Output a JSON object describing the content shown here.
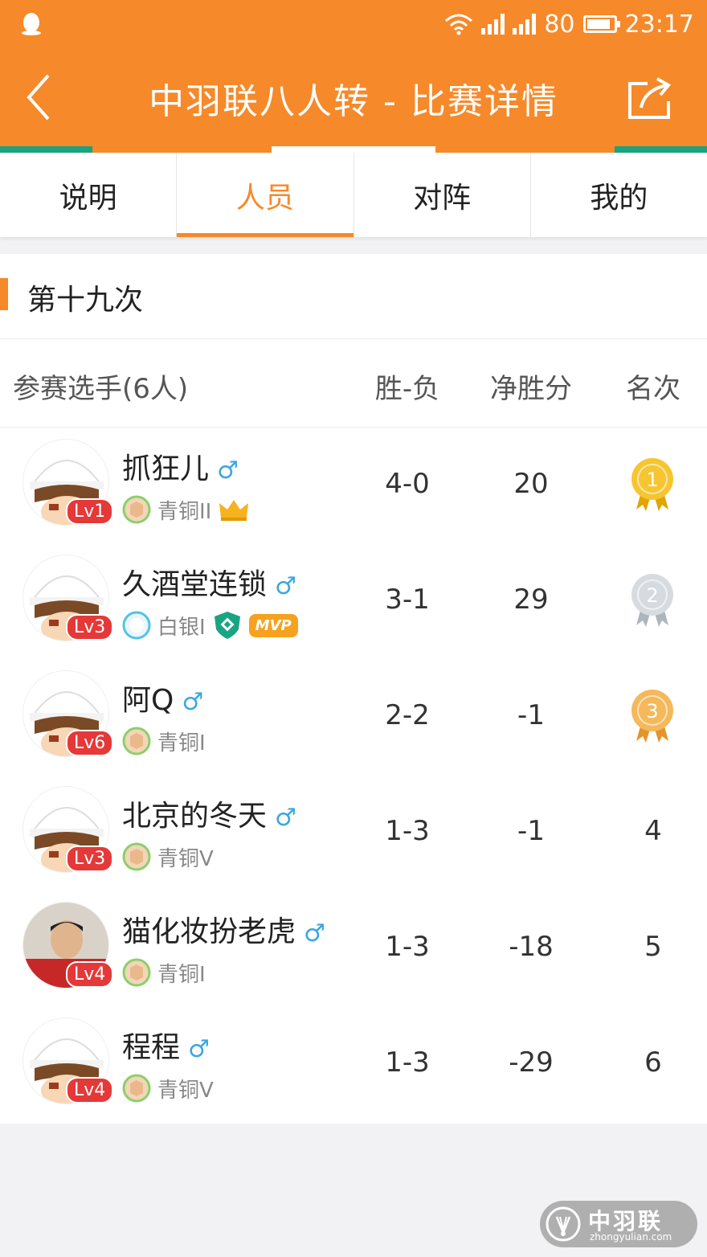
{
  "status_bar": {
    "battery": "80",
    "time": "23:17"
  },
  "header": {
    "title": "中羽联八人转 - 比赛详情",
    "back_icon": "back-icon",
    "share_icon": "share-icon"
  },
  "tabs": [
    {
      "label": "说明",
      "active": false
    },
    {
      "label": "人员",
      "active": true
    },
    {
      "label": "对阵",
      "active": false
    },
    {
      "label": "我的",
      "active": false
    }
  ],
  "section": {
    "title": "第十九次"
  },
  "table": {
    "headers": {
      "players": "参赛选手(6人)",
      "win_loss": "胜-负",
      "net_points": "净胜分",
      "rank": "名次"
    },
    "rows": [
      {
        "name": "抓狂儿",
        "gender": "♂",
        "level": "Lv1",
        "tier": "青铜II",
        "win_loss": "4-0",
        "net": "20",
        "rank": "1",
        "medal": "gold",
        "badges": [
          "crown"
        ],
        "photo": false
      },
      {
        "name": "久酒堂连锁",
        "gender": "♂",
        "level": "Lv3",
        "tier": "白银I",
        "win_loss": "3-1",
        "net": "29",
        "rank": "2",
        "medal": "silver",
        "badges": [
          "shield",
          "MVP"
        ],
        "photo": false
      },
      {
        "name": "阿Q",
        "gender": "♂",
        "level": "Lv6",
        "tier": "青铜I",
        "win_loss": "2-2",
        "net": "-1",
        "rank": "3",
        "medal": "bronze",
        "badges": [],
        "photo": false
      },
      {
        "name": "北京的冬天",
        "gender": "♂",
        "level": "Lv3",
        "tier": "青铜V",
        "win_loss": "1-3",
        "net": "-1",
        "rank": "4",
        "medal": "",
        "badges": [],
        "photo": false
      },
      {
        "name": "猫化妆扮老虎",
        "gender": "♂",
        "level": "Lv4",
        "tier": "青铜I",
        "win_loss": "1-3",
        "net": "-18",
        "rank": "5",
        "medal": "",
        "badges": [],
        "photo": true
      },
      {
        "name": "程程",
        "gender": "♂",
        "level": "Lv4",
        "tier": "青铜V",
        "win_loss": "1-3",
        "net": "-29",
        "rank": "6",
        "medal": "",
        "badges": [],
        "photo": false
      }
    ]
  },
  "watermark": {
    "title": "中羽联",
    "url": "zhongyulian.com"
  },
  "colors": {
    "accent": "#f6892a",
    "teal": "#19a37f",
    "level_badge": "#e53838",
    "male_symbol": "#3aa7e0"
  }
}
